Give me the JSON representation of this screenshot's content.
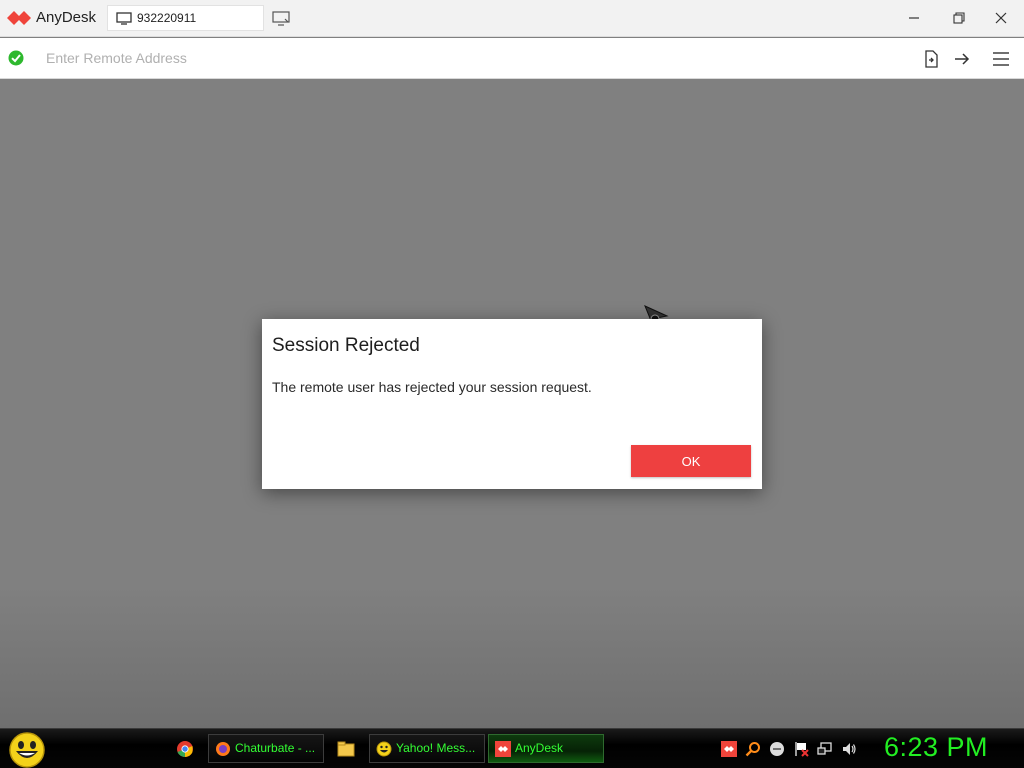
{
  "titlebar": {
    "app_name": "AnyDesk",
    "tab_label": "932220911"
  },
  "addressbar": {
    "placeholder": "Enter Remote Address",
    "value": ""
  },
  "dialog": {
    "title": "Session Rejected",
    "message": "The remote user has rejected your session request.",
    "ok_label": "OK"
  },
  "taskbar": {
    "items": [
      {
        "label": "Chaturbate - ...",
        "icon": "firefox-icon"
      },
      {
        "label": "Yahoo! Mess...",
        "icon": "yahoo-smiley-icon"
      },
      {
        "label": "AnyDesk",
        "icon": "anydesk-icon",
        "active": true
      }
    ],
    "clock": "6:23 PM"
  },
  "colors": {
    "brand_red": "#ef443b",
    "ok_button": "#ee4040",
    "status_green": "#2eb82e",
    "taskbar_text": "#33ff33",
    "remote_background": "#808080"
  }
}
